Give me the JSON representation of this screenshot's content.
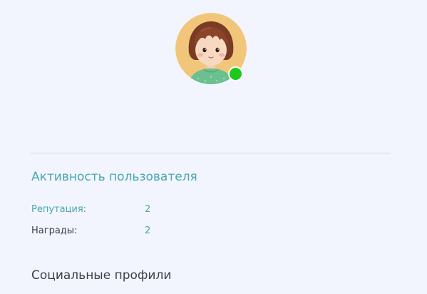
{
  "profile": {
    "status": "online",
    "status_color": "#1cc91c"
  },
  "activity": {
    "title": "Активность пользователя",
    "stats": [
      {
        "label": "Репутация:",
        "value": "2"
      },
      {
        "label": "Награды:",
        "value": "2"
      }
    ]
  },
  "social": {
    "title": "Социальные профили"
  },
  "colors": {
    "background": "#f2f5fd",
    "accent": "#4aa6ad",
    "text": "#3c3f45"
  }
}
